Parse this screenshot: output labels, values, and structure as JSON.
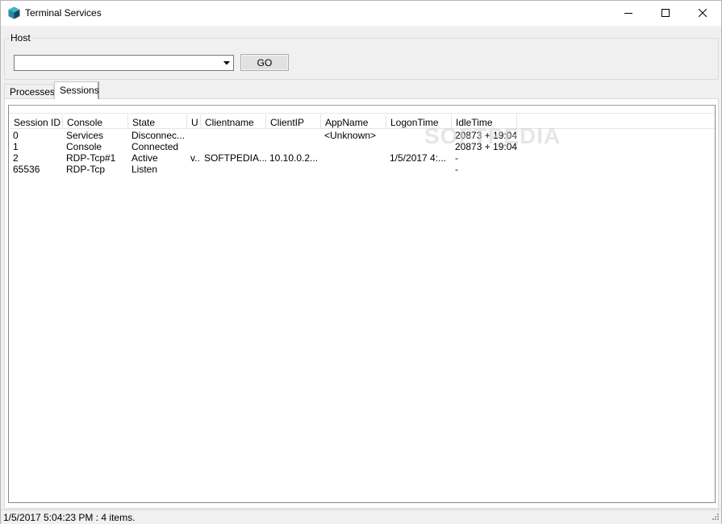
{
  "window": {
    "title": "Terminal Services",
    "icon": "shield-cube-icon"
  },
  "host": {
    "group_label": "Host",
    "value": "",
    "go_label": "GO"
  },
  "tabs": [
    {
      "label": "Processes",
      "selected": false
    },
    {
      "label": "Sessions",
      "selected": true
    }
  ],
  "table": {
    "columns": [
      "Session ID",
      "Console",
      "State",
      "U",
      "Clientname",
      "ClientIP",
      "AppName",
      "LogonTime",
      "IdleTime"
    ],
    "rows": [
      [
        "0",
        "Services",
        "Disconnec...",
        "",
        "",
        "",
        "<Unknown>",
        "",
        "20873 + 19:04"
      ],
      [
        "1",
        "Console",
        "Connected",
        "",
        "",
        "",
        "",
        "",
        "20873 + 19:04"
      ],
      [
        "2",
        "RDP-Tcp#1",
        "Active",
        "v..",
        "SOFTPEDIA...",
        "10.10.0.2...",
        "",
        "1/5/2017 4:...",
        "-"
      ],
      [
        "65536",
        "RDP-Tcp",
        "Listen",
        "",
        "",
        "",
        "",
        "",
        "-"
      ]
    ]
  },
  "watermark": "SOFTPEDIA",
  "status": {
    "text": "1/5/2017 5:04:23 PM : 4 items."
  },
  "colors": {
    "accent": "#0078d7",
    "icon_dark": "#1b5e7a",
    "icon_light": "#3fb5c9"
  }
}
